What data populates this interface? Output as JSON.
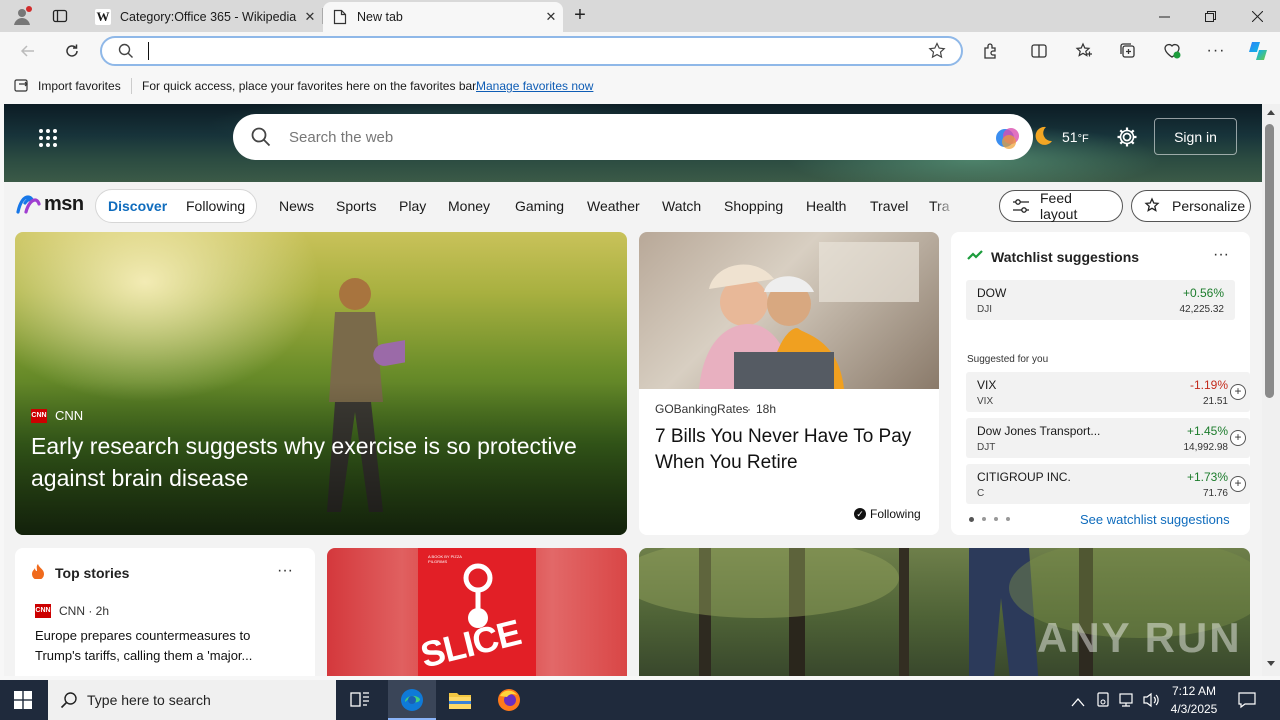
{
  "browser": {
    "tabs": [
      {
        "title": "Category:Office 365 - Wikipedia",
        "favicon": "W",
        "active": false
      },
      {
        "title": "New tab",
        "favicon": "page-icon",
        "active": true
      }
    ],
    "address_value": ""
  },
  "favorites_bar": {
    "import_label": "Import favorites",
    "message": "For quick access, place your favorites here on the favorites bar.",
    "manage_link": "Manage favorites now"
  },
  "msn_header": {
    "search_placeholder": "Search the web",
    "temperature": "51",
    "temp_unit": "°F",
    "sign_in": "Sign in"
  },
  "msn_nav": {
    "logo": "msn",
    "discover": "Discover",
    "following": "Following",
    "links": [
      "News",
      "Sports",
      "Play",
      "Money",
      "Gaming",
      "Weather",
      "Watch",
      "Shopping",
      "Health",
      "Travel",
      "Tra"
    ],
    "feed_layout": "Feed layout",
    "personalize": "Personalize"
  },
  "hero": {
    "source": "CNN",
    "headline": "Early research suggests why exercise is so protective against brain disease"
  },
  "article2": {
    "source": "GOBankingRates",
    "time": "18h",
    "headline": "7 Bills You Never Have To Pay When You Retire",
    "following": "Following"
  },
  "watchlist": {
    "title": "Watchlist suggestions",
    "more": "···",
    "rows": [
      {
        "name": "DOW",
        "ticker": "DJI",
        "change": "+0.56%",
        "value": "42,225.32",
        "dir": "up"
      }
    ],
    "suggested_label": "Suggested for you",
    "suggested": [
      {
        "name": "VIX",
        "ticker": "VIX",
        "change": "-1.19%",
        "value": "21.51",
        "dir": "down"
      },
      {
        "name": "Dow Jones Transport...",
        "ticker": "DJT",
        "change": "+1.45%",
        "value": "14,992.98",
        "dir": "up"
      },
      {
        "name": "CITIGROUP INC.",
        "ticker": "C",
        "change": "+1.73%",
        "value": "71.76",
        "dir": "up"
      }
    ],
    "see_link": "See watchlist suggestions"
  },
  "top_stories": {
    "title": "Top stories",
    "more": "···",
    "source": "CNN",
    "time": "2h",
    "headline": "Europe prepares countermeasures to Trump's tariffs, calling them a 'major..."
  },
  "book_cover": {
    "top_text": "A BOOK BY PIZZA PILGRIMS",
    "word": "SLICE"
  },
  "watermark": "ANY RUN",
  "taskbar": {
    "search_placeholder": "Type here to search",
    "time": "7:12 AM",
    "date": "4/3/2025"
  },
  "colors": {
    "accent": "#0f6cbd",
    "tab_strip": "#d9d9d9",
    "taskbar": "#1f2a3c",
    "up": "#1c7c2c",
    "down": "#c42b1c"
  }
}
